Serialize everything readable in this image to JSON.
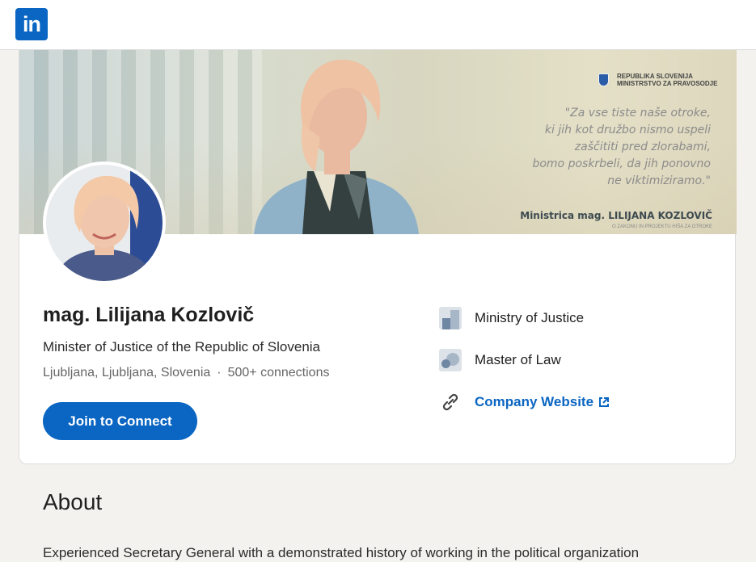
{
  "header": {
    "logo_text": "in",
    "brand_color": "#0a66c2"
  },
  "banner": {
    "org_line1": "REPUBLIKA SLOVENIJA",
    "org_line2": "MINISTRSTVO ZA PRAVOSODJE",
    "quote_lines": [
      "\"Za vse tiste naše otroke,",
      "ki jih kot družbo nismo uspeli",
      "zaščititi pred zlorabami,",
      "bomo poskrbeli, da jih ponovno",
      "ne viktimiziramo.\""
    ],
    "signature": "Ministrica mag. LILIJANA KOZLOVIČ",
    "signature_sub": "O ZAKONU IN PROJEKTU HIŠA ZA OTROKE"
  },
  "profile": {
    "name": "mag. Lilijana Kozlovič",
    "headline": "Minister of Justice of the Republic of Slovenia",
    "location": "Ljubljana, Ljubljana, Slovenia",
    "separator": "·",
    "connections": "500+ connections",
    "connect_label": "Join to Connect"
  },
  "sidebar": {
    "company": "Ministry of Justice",
    "education": "Master of Law",
    "website_label": "Company Website",
    "icons": [
      "building-icon",
      "school-icon",
      "link-icon",
      "external-link-icon"
    ]
  },
  "about": {
    "title": "About",
    "text": "Experienced Secretary General with a demonstrated history of working in the political organization"
  }
}
